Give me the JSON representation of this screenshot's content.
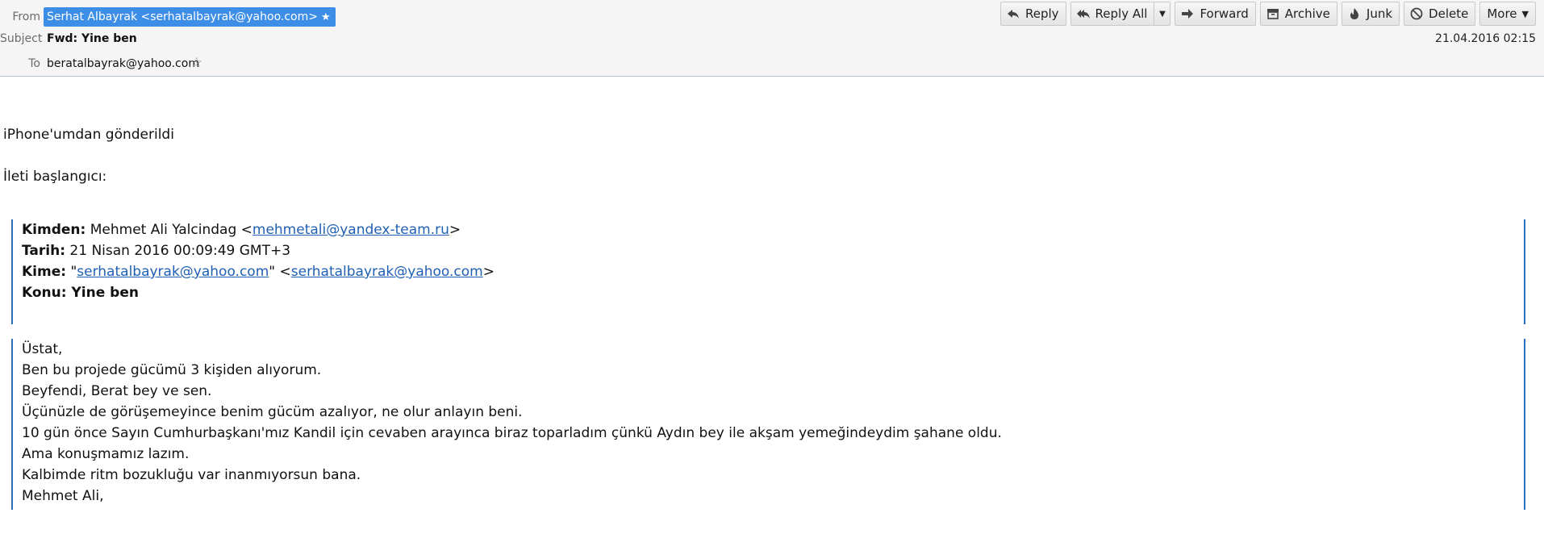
{
  "header": {
    "from_label": "From",
    "from_value": "Serhat Albayrak <serhatalbayrak@yahoo.com>",
    "subject_label": "Subject",
    "subject_value": "Fwd: Yine ben",
    "to_label": "To",
    "to_value": "beratalbayrak@yahoo.com",
    "date": "21.04.2016 02:15"
  },
  "toolbar": {
    "reply": "Reply",
    "reply_all": "Reply All",
    "forward": "Forward",
    "archive": "Archive",
    "junk": "Junk",
    "delete": "Delete",
    "more": "More"
  },
  "body": {
    "sent_from": "iPhone'umdan gönderildi",
    "forward_intro": "İleti başlangıcı:",
    "meta": {
      "from_key": "Kimden:",
      "from_name": " Mehmet Ali Yalcindag <",
      "from_email": "mehmetali@yandex-team.ru",
      "from_close": ">",
      "date_key": "Tarih:",
      "date_val": " 21 Nisan 2016 00:09:49 GMT+3",
      "to_key": "Kime:",
      "to_q1": " \"",
      "to_email1": "serhatalbayrak@yahoo.com",
      "to_q2": "\" <",
      "to_email2": "serhatalbayrak@yahoo.com",
      "to_close": ">",
      "subject_key": "Konu:",
      "subject_val": " Yine ben"
    },
    "lines": [
      "Üstat,",
      "Ben bu projede gücümü 3 kişiden alıyorum.",
      "Beyfendi, Berat bey ve sen.",
      "Üçünüzle de görüşemeyince benim gücüm azalıyor, ne olur anlayın beni.",
      "10 gün önce Sayın Cumhurbaşkanı'mız Kandil için cevaben arayınca biraz toparladım çünkü Aydın bey ile akşam yemeğindeydim şahane oldu.",
      "Ama konuşmamız lazım.",
      "Kalbimde ritm bozukluğu var inanmıyorsun bana.",
      "Mehmet Ali,"
    ]
  }
}
